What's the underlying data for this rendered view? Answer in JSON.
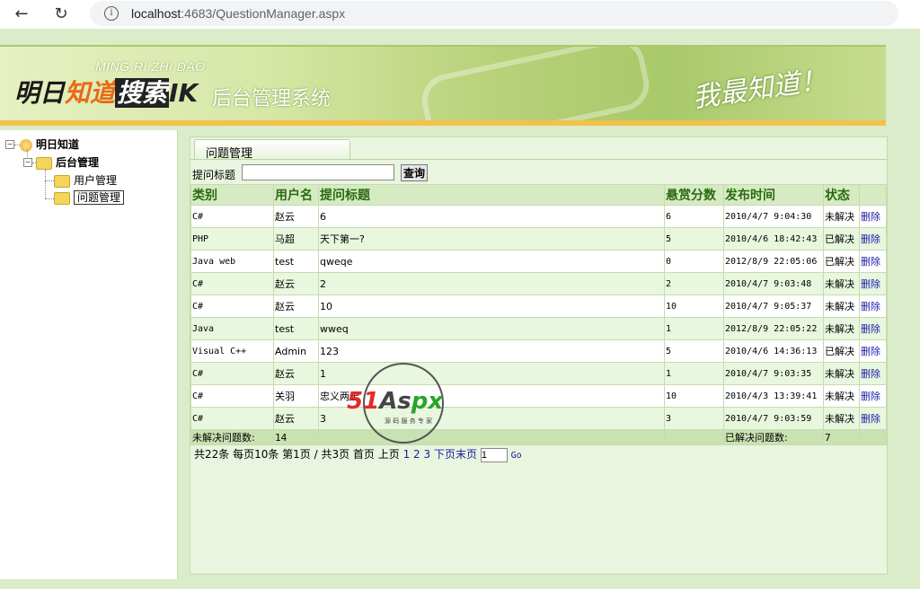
{
  "browser": {
    "url_host": "localhost",
    "url_rest": ":4683/QuestionManager.aspx"
  },
  "banner": {
    "pinyin": "MING RI ZHI DAO",
    "logo_a": "明日",
    "logo_b": "知道",
    "logo_c": "搜索",
    "logo_d": "IK",
    "system_title": "后台管理系统",
    "slogan": "我最知道！"
  },
  "tree": {
    "root": "明日知道",
    "admin": "后台管理",
    "items": [
      "用户管理",
      "问题管理"
    ]
  },
  "main": {
    "tab": "问题管理",
    "search_label": "提问标题",
    "search_value": "",
    "search_button": "查询"
  },
  "table": {
    "headers": [
      "类别",
      "用户名",
      "提问标题",
      "悬赏分数",
      "发布时间",
      "状态",
      ""
    ],
    "rows": [
      {
        "cat": "C#",
        "user": "赵云",
        "title": "6",
        "score": "6",
        "time": "2010/4/7 9:04:30",
        "status": "未解决",
        "action": "删除"
      },
      {
        "cat": "PHP",
        "user": "马超",
        "title": "天下第一?",
        "score": "5",
        "time": "2010/4/6 18:42:43",
        "status": "已解决",
        "action": "删除"
      },
      {
        "cat": "Java web",
        "user": "test",
        "title": "qweqe",
        "score": "0",
        "time": "2012/8/9 22:05:06",
        "status": "已解决",
        "action": "删除"
      },
      {
        "cat": "C#",
        "user": "赵云",
        "title": "2",
        "score": "2",
        "time": "2010/4/7 9:03:48",
        "status": "未解决",
        "action": "删除"
      },
      {
        "cat": "C#",
        "user": "赵云",
        "title": "10",
        "score": "10",
        "time": "2010/4/7 9:05:37",
        "status": "未解决",
        "action": "删除"
      },
      {
        "cat": "Java",
        "user": "test",
        "title": "wweq",
        "score": "1",
        "time": "2012/8/9 22:05:22",
        "status": "未解决",
        "action": "删除"
      },
      {
        "cat": "Visual C++",
        "user": "Admin",
        "title": "123",
        "score": "5",
        "time": "2010/4/6 14:36:13",
        "status": "已解决",
        "action": "删除"
      },
      {
        "cat": "C#",
        "user": "赵云",
        "title": "1",
        "score": "1",
        "time": "2010/4/7 9:03:35",
        "status": "未解决",
        "action": "删除"
      },
      {
        "cat": "C#",
        "user": "关羽",
        "title": "忠义两全",
        "score": "10",
        "time": "2010/4/3 13:39:41",
        "status": "未解决",
        "action": "删除"
      },
      {
        "cat": "C#",
        "user": "赵云",
        "title": "3",
        "score": "3",
        "time": "2010/4/7 9:03:59",
        "status": "未解决",
        "action": "删除"
      }
    ],
    "footer": {
      "unsolved_label": "未解决问题数:",
      "unsolved_value": "14",
      "solved_label": "已解决问题数:",
      "solved_value": "7"
    }
  },
  "pager": {
    "summary": "共22条 每页10条 第1页 / 共3页 首页 上页",
    "pages": "1 2 3",
    "next": "下页",
    "last": "末页",
    "page_input": "1",
    "go": "Go"
  },
  "watermark": {
    "brand_red": "51",
    "brand_gray": "As",
    "brand_green": "px",
    "tagline": "源 码 服 务 专 家"
  }
}
